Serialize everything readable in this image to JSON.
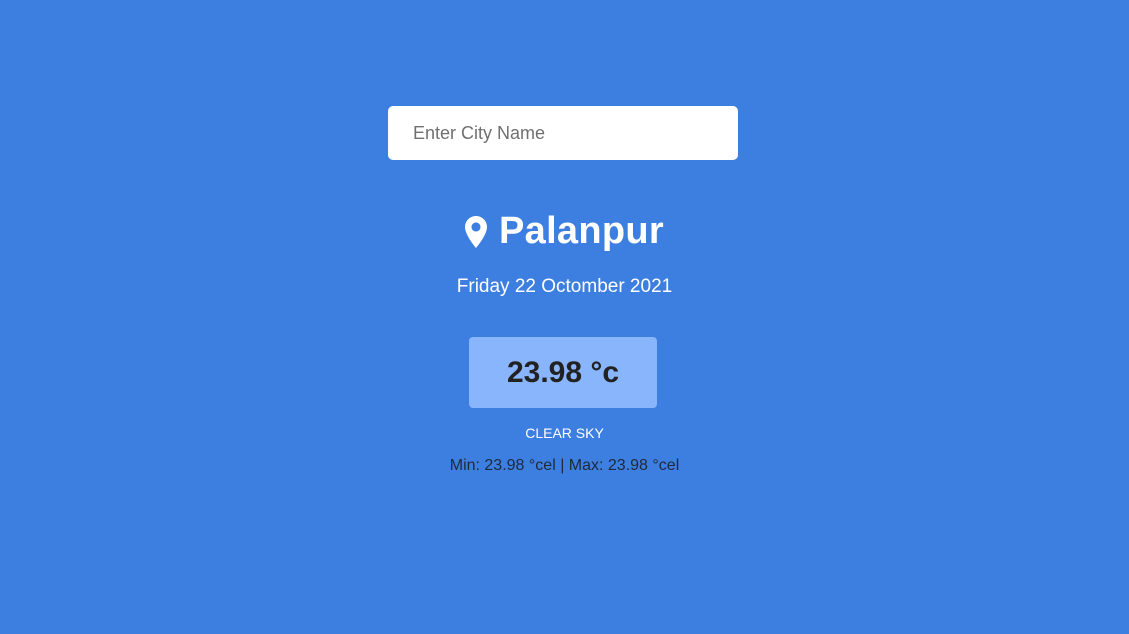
{
  "colors": {
    "background": "#3d7fe0",
    "search_bg": "#ffffff",
    "temp_box_bg": "#88b5fb",
    "text_light": "#ffffff",
    "text_dark": "#222222"
  },
  "search": {
    "placeholder": "Enter City Name",
    "value": ""
  },
  "location": {
    "icon": "map-pin-icon",
    "city": "Palanpur"
  },
  "date": "Friday 22 Octomber 2021",
  "weather": {
    "temperature": "23.98 °c",
    "condition": "CLEAR SKY",
    "min_max": "Min: 23.98 °cel | Max: 23.98 °cel"
  }
}
